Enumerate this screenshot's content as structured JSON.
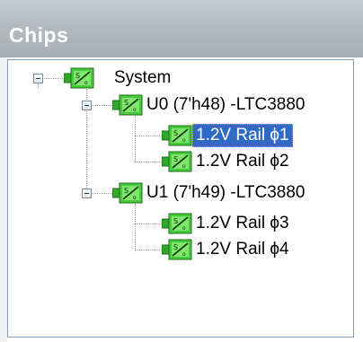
{
  "panel": {
    "title": "Chips"
  },
  "tree": {
    "root": {
      "label": "System"
    },
    "devices": [
      {
        "label": "U0 (7'h48) -LTC3880",
        "rails": [
          {
            "label": "1.2V Rail ϕ1",
            "selected": true
          },
          {
            "label": "1.2V Rail ϕ2",
            "selected": false
          }
        ]
      },
      {
        "label": "U1 (7'h49) -LTC3880",
        "rails": [
          {
            "label": "1.2V Rail ϕ3",
            "selected": false
          },
          {
            "label": "1.2V Rail ϕ4",
            "selected": false
          }
        ]
      }
    ]
  },
  "icons": {
    "chip": "power-module-icon",
    "expander": "collapse-icon"
  },
  "colors": {
    "selection": "#316ac5",
    "icon_green": "#3fbf2f",
    "header": "#b4bac0"
  }
}
